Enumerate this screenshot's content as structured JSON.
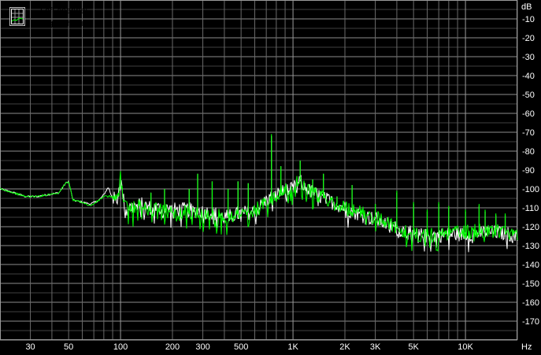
{
  "chart_data": {
    "type": "line",
    "xscale": "log",
    "xlim": [
      20,
      20000
    ],
    "ylim": [
      -180,
      0
    ],
    "ylabel": "dB",
    "xlabel": "Hz",
    "grid": true,
    "y_ticks": [
      -10,
      -20,
      -30,
      -40,
      -50,
      -60,
      -70,
      -80,
      -90,
      -100,
      -110,
      -120,
      -130,
      -140,
      -150,
      -160,
      -170
    ],
    "x_ticks": [
      {
        "value": 30,
        "label": "30"
      },
      {
        "value": 50,
        "label": "50"
      },
      {
        "value": 100,
        "label": "100"
      },
      {
        "value": 200,
        "label": "200"
      },
      {
        "value": 300,
        "label": "300"
      },
      {
        "value": 500,
        "label": "500"
      },
      {
        "value": 1000,
        "label": "1K"
      },
      {
        "value": 2000,
        "label": "2K"
      },
      {
        "value": 3000,
        "label": "3K"
      },
      {
        "value": 5000,
        "label": "5K"
      },
      {
        "value": 10000,
        "label": "10K"
      }
    ],
    "legend_position": "top-left",
    "series": [
      {
        "name": "Left channel",
        "color": "#ffffff",
        "points": [
          [
            20,
            -100
          ],
          [
            24,
            -102
          ],
          [
            28,
            -104
          ],
          [
            33,
            -104
          ],
          [
            38,
            -103
          ],
          [
            44,
            -102
          ],
          [
            48,
            -97
          ],
          [
            50,
            -96
          ],
          [
            53,
            -106
          ],
          [
            60,
            -107
          ],
          [
            67,
            -108
          ],
          [
            75,
            -106
          ],
          [
            80,
            -103
          ],
          [
            85,
            -99
          ],
          [
            88,
            -103
          ],
          [
            95,
            -107
          ],
          [
            100,
            -95
          ],
          [
            105,
            -108
          ],
          [
            115,
            -110
          ],
          [
            130,
            -108
          ],
          [
            150,
            -110
          ],
          [
            200,
            -111
          ],
          [
            250,
            -111
          ],
          [
            300,
            -112
          ],
          [
            350,
            -113
          ],
          [
            400,
            -115
          ],
          [
            500,
            -113
          ],
          [
            600,
            -112
          ],
          [
            700,
            -106
          ],
          [
            800,
            -103
          ],
          [
            900,
            -101
          ],
          [
            1000,
            -100
          ],
          [
            1100,
            -96
          ],
          [
            1200,
            -100
          ],
          [
            1500,
            -105
          ],
          [
            2000,
            -110
          ],
          [
            2500,
            -114
          ],
          [
            3000,
            -116
          ],
          [
            4000,
            -121
          ],
          [
            5000,
            -124
          ],
          [
            6000,
            -125
          ],
          [
            8000,
            -124
          ],
          [
            10000,
            -124
          ],
          [
            12000,
            -123
          ],
          [
            15000,
            -123
          ],
          [
            18000,
            -124
          ],
          [
            20000,
            -126
          ]
        ],
        "peaks": [
          [
            96,
            -103
          ],
          [
            150,
            -102
          ],
          [
            180,
            -100
          ],
          [
            250,
            -100
          ],
          [
            280,
            -92
          ],
          [
            340,
            -96
          ],
          [
            420,
            -100
          ],
          [
            480,
            -96
          ],
          [
            550,
            -97
          ],
          [
            750,
            -72
          ],
          [
            850,
            -88
          ],
          [
            1100,
            -85
          ],
          [
            1300,
            -95
          ],
          [
            1500,
            -92
          ],
          [
            1800,
            -104
          ],
          [
            2200,
            -98
          ],
          [
            3000,
            -108
          ],
          [
            4000,
            -102
          ],
          [
            5000,
            -108
          ],
          [
            6000,
            -112
          ],
          [
            7000,
            -108
          ],
          [
            8000,
            -110
          ],
          [
            10000,
            -112
          ],
          [
            12000,
            -109
          ],
          [
            13000,
            -112
          ],
          [
            15000,
            -114
          ],
          [
            17000,
            -114
          ]
        ]
      },
      {
        "name": "Right channel",
        "color": "#00ff00",
        "points": [
          [
            20,
            -100
          ],
          [
            24,
            -102
          ],
          [
            28,
            -104
          ],
          [
            33,
            -104
          ],
          [
            38,
            -103
          ],
          [
            44,
            -102
          ],
          [
            48,
            -97
          ],
          [
            50,
            -96
          ],
          [
            53,
            -106
          ],
          [
            60,
            -107
          ],
          [
            67,
            -109
          ],
          [
            75,
            -106
          ],
          [
            80,
            -104
          ],
          [
            85,
            -104
          ],
          [
            90,
            -104
          ],
          [
            95,
            -106
          ],
          [
            100,
            -93
          ],
          [
            105,
            -108
          ],
          [
            115,
            -111
          ],
          [
            130,
            -108
          ],
          [
            150,
            -111
          ],
          [
            200,
            -112
          ],
          [
            250,
            -112
          ],
          [
            300,
            -113
          ],
          [
            350,
            -114
          ],
          [
            400,
            -115
          ],
          [
            500,
            -113
          ],
          [
            600,
            -112
          ],
          [
            700,
            -106
          ],
          [
            800,
            -103
          ],
          [
            900,
            -101
          ],
          [
            1000,
            -99
          ],
          [
            1100,
            -95
          ],
          [
            1200,
            -100
          ],
          [
            1500,
            -105
          ],
          [
            2000,
            -110
          ],
          [
            2500,
            -113
          ],
          [
            3000,
            -115
          ],
          [
            4000,
            -120
          ],
          [
            5000,
            -124
          ],
          [
            6000,
            -125
          ],
          [
            8000,
            -123
          ],
          [
            10000,
            -123
          ],
          [
            12000,
            -122
          ],
          [
            15000,
            -122
          ],
          [
            18000,
            -123
          ],
          [
            20000,
            -125
          ]
        ],
        "peaks": [
          [
            96,
            -103
          ],
          [
            150,
            -102
          ],
          [
            180,
            -100
          ],
          [
            250,
            -100
          ],
          [
            280,
            -92
          ],
          [
            340,
            -96
          ],
          [
            420,
            -100
          ],
          [
            480,
            -96
          ],
          [
            550,
            -97
          ],
          [
            750,
            -71
          ],
          [
            850,
            -88
          ],
          [
            1100,
            -85
          ],
          [
            1300,
            -95
          ],
          [
            1500,
            -92
          ],
          [
            1800,
            -104
          ],
          [
            2200,
            -98
          ],
          [
            3000,
            -108
          ],
          [
            4000,
            -101
          ],
          [
            5000,
            -107
          ],
          [
            6000,
            -111
          ],
          [
            7000,
            -107
          ],
          [
            8000,
            -109
          ],
          [
            10000,
            -111
          ],
          [
            12000,
            -108
          ],
          [
            13000,
            -111
          ],
          [
            15000,
            -113
          ],
          [
            17000,
            -113
          ]
        ]
      }
    ]
  }
}
